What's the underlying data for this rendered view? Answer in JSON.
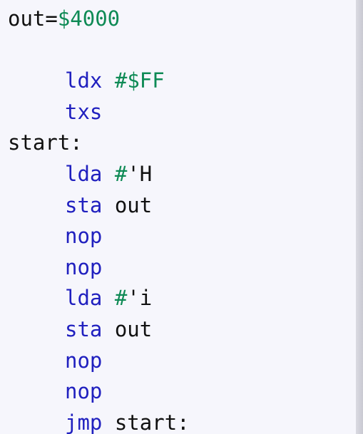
{
  "lines": [
    {
      "indent": false,
      "parts": [
        {
          "text": "out=",
          "cls": "plain"
        },
        {
          "text": "$4000",
          "cls": "num"
        }
      ]
    },
    {
      "indent": false,
      "parts": []
    },
    {
      "indent": true,
      "parts": [
        {
          "text": "ldx",
          "cls": "kw"
        },
        {
          "text": " ",
          "cls": "plain"
        },
        {
          "text": "#$FF",
          "cls": "num"
        }
      ]
    },
    {
      "indent": true,
      "parts": [
        {
          "text": "txs",
          "cls": "kw"
        }
      ]
    },
    {
      "indent": false,
      "parts": [
        {
          "text": "start:",
          "cls": "plain"
        }
      ]
    },
    {
      "indent": true,
      "parts": [
        {
          "text": "lda",
          "cls": "kw"
        },
        {
          "text": " ",
          "cls": "plain"
        },
        {
          "text": "#",
          "cls": "num"
        },
        {
          "text": "'H",
          "cls": "plain"
        }
      ]
    },
    {
      "indent": true,
      "parts": [
        {
          "text": "sta",
          "cls": "kw"
        },
        {
          "text": " out",
          "cls": "plain"
        }
      ]
    },
    {
      "indent": true,
      "parts": [
        {
          "text": "nop",
          "cls": "kw"
        }
      ]
    },
    {
      "indent": true,
      "parts": [
        {
          "text": "nop",
          "cls": "kw"
        }
      ]
    },
    {
      "indent": true,
      "parts": [
        {
          "text": "lda",
          "cls": "kw"
        },
        {
          "text": " ",
          "cls": "plain"
        },
        {
          "text": "#",
          "cls": "num"
        },
        {
          "text": "'i",
          "cls": "plain"
        }
      ]
    },
    {
      "indent": true,
      "parts": [
        {
          "text": "sta",
          "cls": "kw"
        },
        {
          "text": " out",
          "cls": "plain"
        }
      ]
    },
    {
      "indent": true,
      "parts": [
        {
          "text": "nop",
          "cls": "kw"
        }
      ]
    },
    {
      "indent": true,
      "parts": [
        {
          "text": "nop",
          "cls": "kw"
        }
      ]
    },
    {
      "indent": true,
      "parts": [
        {
          "text": "jmp",
          "cls": "kw"
        },
        {
          "text": " start:",
          "cls": "plain"
        }
      ]
    }
  ],
  "colors": {
    "background": "#f6f6fc",
    "keyword": "#2020bf",
    "number": "#0e8a55",
    "text": "#111111"
  }
}
